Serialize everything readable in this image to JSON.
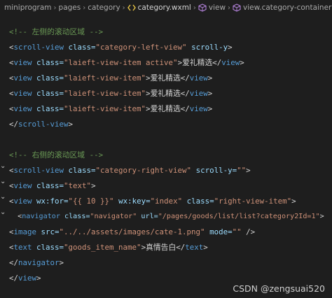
{
  "breadcrumb": {
    "items": [
      "miniprogram",
      "pages",
      "category",
      "category.wxml",
      "view",
      "view.category-container"
    ],
    "sep_glyph": "›"
  },
  "code": {
    "l1": {
      "comment": "<!-- 左侧的滚动区域 -->"
    },
    "l2": {
      "open": "<",
      "tag": "scroll-view",
      "attr1": " class=",
      "val1": "\"category-left-view\"",
      "attr2": " scroll-y",
      "close": ">"
    },
    "l3": {
      "open": "<",
      "tag": "view",
      "attr1": " class=",
      "val1": "\"laieft-view-item active\"",
      "gt": ">",
      "text": "爱礼精选",
      "endopen": "</",
      "endtag": "view",
      "endclose": ">"
    },
    "l4": {
      "open": "<",
      "tag": "view",
      "attr1": " class=",
      "val1": "\"laieft-view-item\"",
      "gt": ">",
      "text": "爱礼精选",
      "endopen": "</",
      "endtag": "view",
      "endclose": ">"
    },
    "l5": {
      "open": "<",
      "tag": "view",
      "attr1": " class=",
      "val1": "\"laieft-view-item\"",
      "gt": ">",
      "text": "爱礼精选",
      "endopen": "</",
      "endtag": "view",
      "endclose": ">"
    },
    "l6": {
      "open": "<",
      "tag": "view",
      "attr1": " class=",
      "val1": "\"laieft-view-item\"",
      "gt": ">",
      "text": "爱礼精选",
      "endopen": "</",
      "endtag": "view",
      "endclose": ">"
    },
    "l7": {
      "open": "</",
      "tag": "scroll-view",
      "close": ">"
    },
    "l8": {
      "comment": "<!-- 右侧的滚动区域 -->"
    },
    "l9": {
      "open": "<",
      "tag": "scroll-view",
      "attr1": " class=",
      "val1": "\"category-right-view\"",
      "attr2": " scroll-y=",
      "val2": "\"\"",
      "close": ">"
    },
    "l10": {
      "open": "<",
      "tag": "view",
      "attr1": " class=",
      "val1": "\"text\"",
      "close": ">"
    },
    "l11": {
      "open": "<",
      "tag": "view",
      "attr1": " wx:for=",
      "val1": "\"{{ 10 }}\"",
      "attr2": " wx:key=",
      "val2": "\"index\"",
      "attr3": " class=",
      "val3": "\"right-view-item\"",
      "close": ">"
    },
    "l12": {
      "indent": "  ",
      "open": "<",
      "tag": "navigator",
      "attr1": " class=",
      "val1": "\"navigator\"",
      "attr2": " url=",
      "val2": "\"/pages/goods/list/list?category2Id=1\"",
      "close": ">"
    },
    "l13": {
      "open": "<",
      "tag": "image",
      "attr1": " src=",
      "val1": "\"../../assets/images/cate-1.png\"",
      "attr2": " mode=",
      "val2": "\"\"",
      "close": " />"
    },
    "l14": {
      "open": "<",
      "tag": "text",
      "attr1": " class=",
      "val1": "\"goods_item_name\"",
      "gt": ">",
      "text": "真情告白",
      "endopen": "</",
      "endtag": "text",
      "endclose": ">"
    },
    "l15": {
      "open": "</",
      "tag": "navigator",
      "close": ">"
    },
    "l16": {
      "open": "</",
      "tag": "view",
      "close": ">"
    }
  },
  "fold_glyph": "⌄",
  "watermark": "CSDN @zengsuai520",
  "colors": {
    "background": "#1e1e1e",
    "comment": "#6a9955",
    "tag": "#569cd6",
    "attribute": "#9cdcfe",
    "string": "#ce9178",
    "text": "#d4d4d4"
  }
}
